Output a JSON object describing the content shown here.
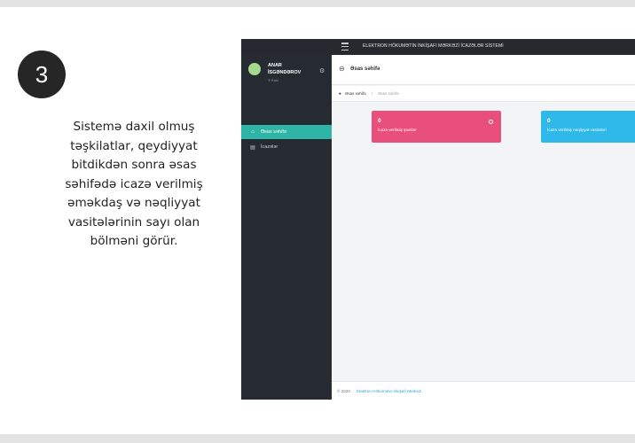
{
  "slide": {
    "step_number": "3",
    "description": "Sistemə daxil olmuş təşkilatlar, qeydiyyat bitdikdən sonra əsas səhifədə icazə verilmiş əməkdaş və nəqliyyat vasitələrinin sayı olan bölməni görür."
  },
  "app": {
    "topbar_title": "ELEKTRON HÖKUMƏTİN İNKİŞAFI MƏRKƏZİ İCAZƏLƏR SİSTEMİ",
    "user": {
      "first_name": "ANAR",
      "last_name": "İSGƏNDƏROV",
      "location": "Baki"
    },
    "nav": {
      "home": "Əsas səhifə",
      "permissions": "İcazələr"
    },
    "page_title": "Əsas səhifə",
    "breadcrumb": {
      "link": "Əsas səhifə",
      "separator": "/",
      "current": "Əsas səhifə"
    },
    "cards": {
      "persons": {
        "count": "0",
        "label": "İcazə verilmiş şəxslər",
        "color": "#e94f7d"
      },
      "vehicles": {
        "count": "0",
        "label": "İcazə verilmiş nəqliyyat vasitələri",
        "color": "#2fb8ea"
      }
    },
    "footer": {
      "copyright": "© 2020.",
      "link": "Elektron Hökumətin İnkişafı Mərkəzi"
    },
    "colors": {
      "sidebar": "#252b30",
      "accent": "#2fb5a5"
    }
  }
}
